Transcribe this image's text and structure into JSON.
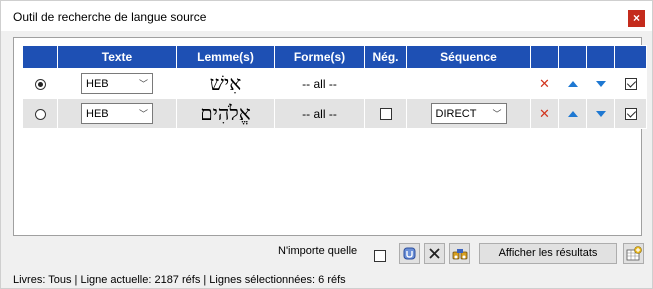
{
  "window": {
    "title": "Outil de recherche de langue source",
    "close_glyph": "×"
  },
  "grid": {
    "headers": [
      "",
      "Texte",
      "Lemme(s)",
      "Forme(s)",
      "Nég.",
      "Séquence",
      "",
      "",
      "",
      ""
    ],
    "rows": [
      {
        "selected": true,
        "text": "HEB",
        "lemma": "אִישׁ",
        "forms": "-- all --",
        "negation": null,
        "sequence": null,
        "included": true
      },
      {
        "selected": false,
        "text": "HEB",
        "lemma": "אֱלֹהִים",
        "forms": "-- all --",
        "negation": false,
        "sequence": "DIRECT",
        "included": true
      }
    ]
  },
  "icons": {
    "delete": "delete-icon",
    "up": "arrow-up-icon",
    "down": "arrow-down-icon",
    "dropdown_glyph": "﹀",
    "delete_glyph": "✕"
  },
  "bottom": {
    "any_label": "N'importe quelle",
    "results_button": "Afficher les résultats"
  },
  "status": "Livres: Tous | Ligne actuelle: 2187 réfs | Lignes sélectionnées: 6 réfs",
  "colors": {
    "header_bg": "#1e50b4",
    "close_bg": "#c42b1c",
    "delete_red": "#d2351e",
    "arrow_blue": "#1e78d2"
  }
}
